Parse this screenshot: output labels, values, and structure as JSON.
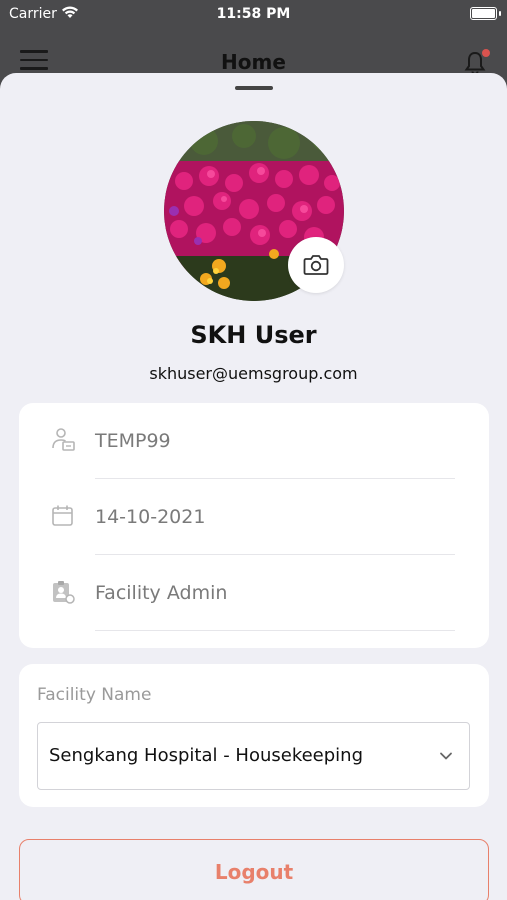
{
  "status_bar": {
    "carrier": "Carrier",
    "time": "11:58 PM"
  },
  "header": {
    "title": "Home"
  },
  "profile": {
    "name": "SKH User",
    "email": "skhuser@uemsgroup.com"
  },
  "info": {
    "user_id": "TEMP99",
    "date": "14-10-2021",
    "role": "Facility Admin"
  },
  "facility": {
    "label": "Facility Name",
    "selected": "Sengkang Hospital - Housekeeping"
  },
  "logout_label": "Logout",
  "colors": {
    "accent": "#e8806b",
    "sheet_bg": "#efeff5",
    "card_bg": "#ffffff",
    "notification_dot": "#d9534f"
  },
  "icons": [
    "wifi-icon",
    "battery-icon",
    "menu-icon",
    "bell-icon",
    "camera-icon",
    "user-badge-icon",
    "calendar-icon",
    "clipboard-user-icon",
    "chevron-down-icon"
  ]
}
